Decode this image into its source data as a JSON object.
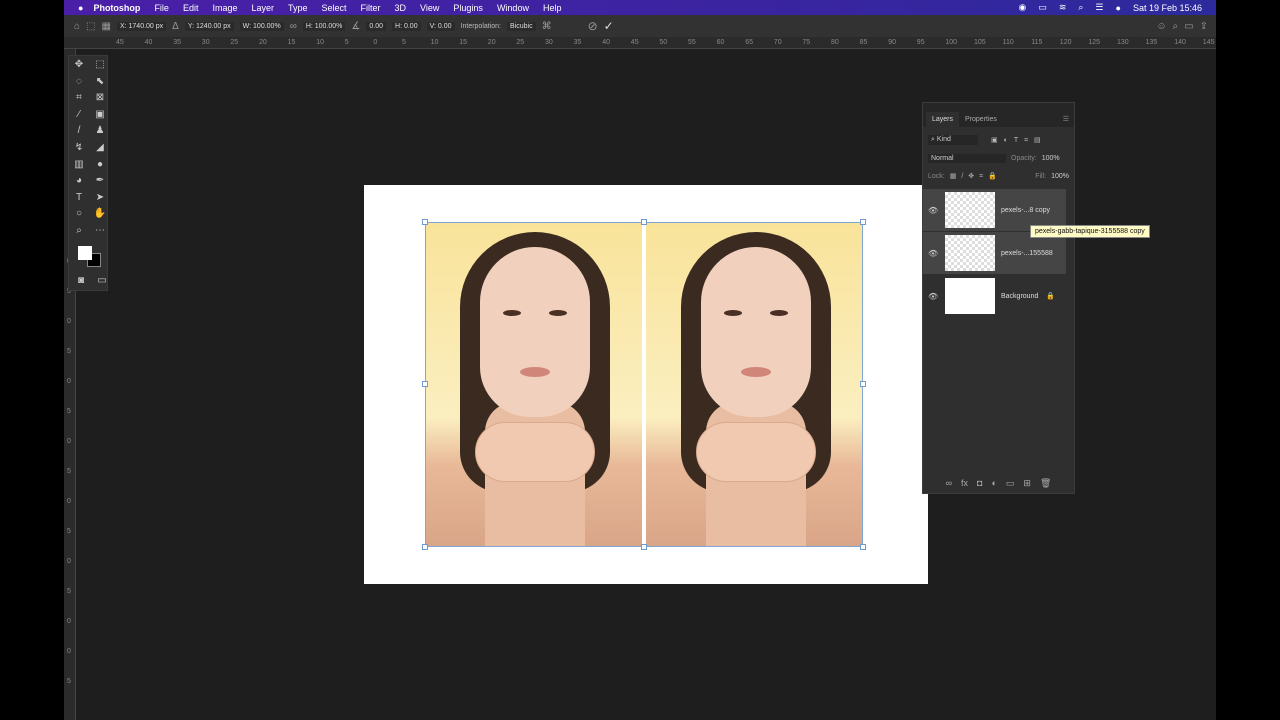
{
  "menubar": {
    "app": "Photoshop",
    "items": [
      "File",
      "Edit",
      "Image",
      "Layer",
      "Type",
      "Select",
      "Filter",
      "3D",
      "View",
      "Plugins",
      "Window",
      "Help"
    ],
    "datetime": "Sat 19 Feb  15:46"
  },
  "options": {
    "x": "X: 1740.00 px",
    "y": "Y: 1240.00 px",
    "w": "W: 100.00%",
    "h": "H: 100.00%",
    "angle": "0.00",
    "hskew": "H: 0.00",
    "vskew": "V: 0.00",
    "interp_label": "Interpolation:",
    "interp": "Bicubic"
  },
  "hruler": [
    "45",
    "40",
    "35",
    "30",
    "25",
    "20",
    "15",
    "10",
    "5",
    "0",
    "5",
    "10",
    "15",
    "20",
    "25",
    "30",
    "35",
    "40",
    "45",
    "50",
    "55",
    "60",
    "65",
    "70",
    "75",
    "80",
    "85",
    "90",
    "95",
    "100",
    "105",
    "110",
    "115",
    "120",
    "125",
    "130",
    "135",
    "140",
    "145"
  ],
  "vruler": [
    "0",
    "5",
    "0",
    "5",
    "0",
    "5",
    "0",
    "5",
    "0",
    "5",
    "0",
    "5",
    "0",
    "0",
    "5"
  ],
  "layers_panel": {
    "tabs": [
      "Layers",
      "Properties"
    ],
    "filter": "Kind",
    "blend": "Normal",
    "opacity_label": "Opacity:",
    "opacity": "100%",
    "lock_label": "Lock:",
    "fill_label": "Fill:",
    "fill": "100%",
    "layers": [
      {
        "name": "pexels-...8 copy"
      },
      {
        "name": "pexels-...155588"
      },
      {
        "name": "Background"
      }
    ],
    "tooltip": "pexels-gabb-tapique-3155588 copy"
  }
}
